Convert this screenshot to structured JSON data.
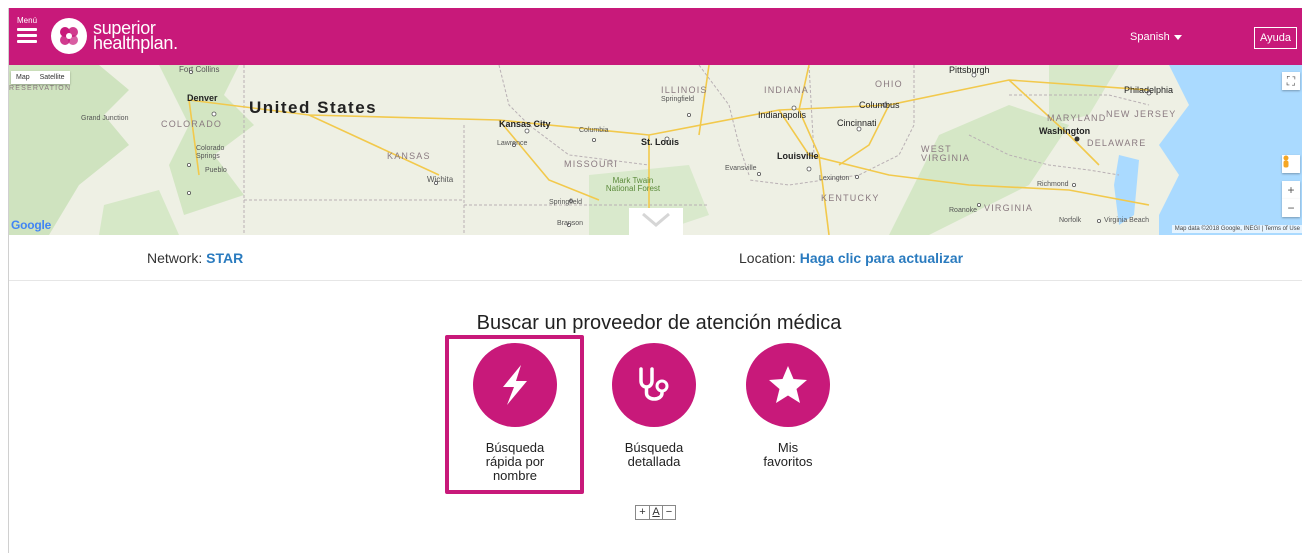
{
  "header": {
    "menu_label": "Menú",
    "logo_line1": "superior",
    "logo_line2": "healthplan.",
    "language": "Spanish",
    "help_label": "Ayuda",
    "brand_color": "#c8197a"
  },
  "map": {
    "map_label": "Map",
    "satellite_label": "Satellite",
    "google_label": "Google",
    "attribution": "Map data ©2018 Google, INEGI  |  Terms of Use",
    "labels": {
      "country": "United States",
      "denver": "Denver",
      "colorado": "COLORADO",
      "grand_junction": "Grand Junction",
      "colorado_springs": "Colorado Springs",
      "pueblo": "Pueblo",
      "fort_collins": "Fort Collins",
      "reservation": "RESERVATION",
      "kansas": "KANSAS",
      "wichita": "Wichita",
      "kansas_city": "Kansas City",
      "lawrence": "Lawrence",
      "columbia": "Columbia",
      "st_louis": "St. Louis",
      "missouri": "MISSOURI",
      "springfield_mo": "Springfield",
      "branson": "Branson",
      "mark_twain": "Mark Twain National Forest",
      "illinois": "ILLINOIS",
      "springfield_il": "Springfield",
      "indiana": "INDIANA",
      "indianapolis": "Indianapolis",
      "evansville": "Evansville",
      "louisville": "Louisville",
      "lexington": "Lexington",
      "kentucky": "KENTUCKY",
      "ohio": "OHIO",
      "columbus": "Columbus",
      "cincinnati": "Cincinnati",
      "pittsburgh": "Pittsburgh",
      "west_virginia": "WEST VIRGINIA",
      "virginia": "VIRGINIA",
      "roanoke": "Roanoke",
      "richmond": "Richmond",
      "norfolk": "Norfolk",
      "virginia_beach": "Virginia Beach",
      "washington": "Washington",
      "maryland": "MARYLAND",
      "new_jersey": "NEW JERSEY",
      "delaware": "DELAWARE",
      "philadelphia": "Philadelphia"
    }
  },
  "info": {
    "network_label": "Network:",
    "network_value": "STAR",
    "location_label": "Location:",
    "location_value": "Haga clic para actualizar"
  },
  "search": {
    "title": "Buscar un proveedor de atención médica",
    "options": [
      {
        "label_lines": [
          "Búsqueda",
          "rápida por",
          "nombre"
        ],
        "icon": "lightning-icon"
      },
      {
        "label_lines": [
          "Búsqueda",
          "detallada"
        ],
        "icon": "stethoscope-icon"
      },
      {
        "label_lines": [
          "Mis",
          "favoritos"
        ],
        "icon": "star-icon"
      }
    ]
  },
  "font_sizer": {
    "increase": "+",
    "reset": "A",
    "decrease": "−"
  }
}
